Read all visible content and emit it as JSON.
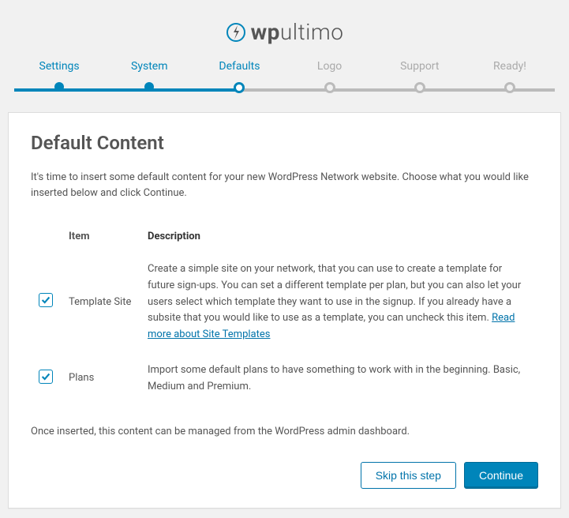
{
  "brand": {
    "bold": "wp",
    "light": "ultimo"
  },
  "stepper": {
    "steps": [
      {
        "label": "Settings"
      },
      {
        "label": "System"
      },
      {
        "label": "Defaults"
      },
      {
        "label": "Logo"
      },
      {
        "label": "Support"
      },
      {
        "label": "Ready!"
      }
    ]
  },
  "page": {
    "title": "Default Content",
    "intro": "It's time to insert some default content for your new WordPress Network website. Choose what you would like inserted below and click Continue.",
    "outro": "Once inserted, this content can be managed from the WordPress admin dashboard."
  },
  "table": {
    "headers": {
      "item": "Item",
      "description": "Description"
    },
    "rows": [
      {
        "checked": true,
        "item": "Template Site",
        "description": "Create a simple site on your network, that you can use to create a template for future sign-ups. You can set a different template per plan, but you can also let your users select which template they want to use in the signup. If you already have a subsite that you would like to use as a template, you can uncheck this item. ",
        "link": "Read more about Site Templates"
      },
      {
        "checked": true,
        "item": "Plans",
        "description": "Import some default plans to have something to work with in the beginning. Basic, Medium and Premium."
      }
    ]
  },
  "actions": {
    "skip": "Skip this step",
    "continue": "Continue"
  }
}
